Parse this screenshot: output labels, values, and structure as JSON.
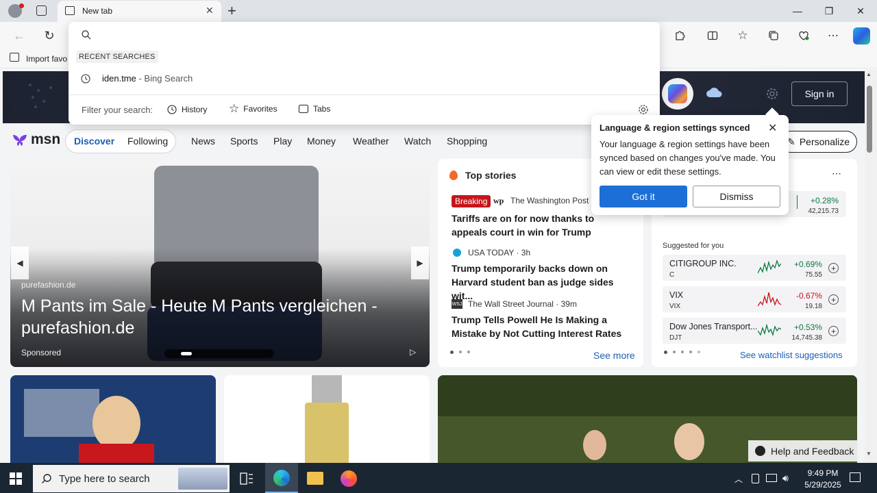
{
  "browser": {
    "tab_title": "New tab",
    "import_favorites": "Import favo",
    "minimize": "—",
    "maximize": "❐",
    "close": "✕"
  },
  "dropdown": {
    "recent_label": "RECENT SEARCHES",
    "recent_item": "iden.tme",
    "recent_item_suffix": " - Bing Search",
    "filter_label": "Filter your search:",
    "filters": [
      "History",
      "Favorites",
      "Tabs"
    ]
  },
  "msn": {
    "logo": "msn",
    "sign_in": "Sign in",
    "nav_pill": [
      "Discover",
      "Following"
    ],
    "nav": [
      "News",
      "Sports",
      "Play",
      "Money",
      "Weather",
      "Watch",
      "Shopping"
    ],
    "personalize": "Personalize"
  },
  "hero": {
    "source": "purefashion.de",
    "title": "M Pants im Sale - Heute M Pants vergleichen - purefashion.de",
    "sponsored": "Sponsored"
  },
  "top_stories": {
    "title": "Top stories",
    "breaking": "Breaking",
    "items": [
      {
        "source": "The Washington Post ·",
        "headline": "Tariffs are on for now thanks to appeals court in win for Trump"
      },
      {
        "source": "USA TODAY · 3h",
        "headline": "Trump temporarily backs down on Harvard student ban as judge sides wit..."
      },
      {
        "source": "The Wall Street Journal · 39m",
        "headline": "Trump Tells Powell He Is Making a Mistake by Not Cutting Interest Rates"
      }
    ],
    "see_more": "See more"
  },
  "markets": {
    "top_row": {
      "pct": "+0.28%",
      "price": "42,215.73"
    },
    "suggested_label": "Suggested for you",
    "rows": [
      {
        "name": "CITIGROUP INC.",
        "symbol": "C",
        "pct": "+0.69%",
        "price": "75.55",
        "color": "#0a7a3f"
      },
      {
        "name": "VIX",
        "symbol": "VIX",
        "pct": "-0.67%",
        "price": "19.18",
        "color": "#c4161c"
      },
      {
        "name": "Dow Jones Transport...",
        "symbol": "DJT",
        "pct": "+0.53%",
        "price": "14,745.38",
        "color": "#0a7a3f"
      }
    ],
    "see_watchlist": "See watchlist suggestions"
  },
  "sync_popup": {
    "title": "Language & region settings synced",
    "body": "Your language & region settings have been synced based on changes you've made. You can view or edit these settings.",
    "got_it": "Got it",
    "dismiss": "Dismiss"
  },
  "help": "Help and Feedback",
  "taskbar": {
    "search_placeholder": "Type here to search",
    "time": "9:49 PM",
    "date": "5/29/2025"
  }
}
